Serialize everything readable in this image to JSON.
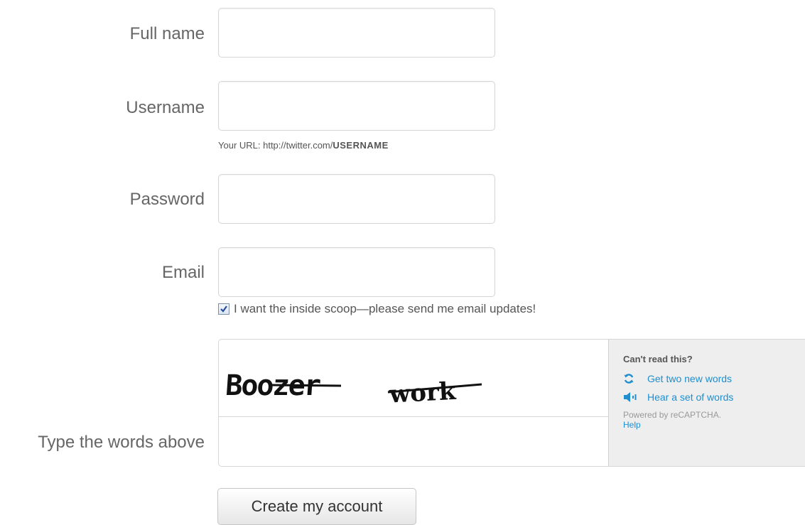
{
  "form": {
    "full_name": {
      "label": "Full name",
      "value": ""
    },
    "username": {
      "label": "Username",
      "value": "",
      "hint_prefix": "Your URL: http://twitter.com/",
      "hint_bold": "USERNAME"
    },
    "password": {
      "label": "Password",
      "value": ""
    },
    "email": {
      "label": "Email",
      "value": ""
    },
    "email_updates": {
      "checked": true,
      "label": "I want the inside scoop—please send me email updates!"
    },
    "captcha": {
      "label": "Type the words above",
      "words": [
        "Boozer",
        "work"
      ],
      "value": "",
      "side": {
        "heading": "Can't read this?",
        "new_words_link": "Get two new words",
        "audio_link": "Hear a set of words",
        "powered_by": "Powered by reCAPTCHA.",
        "help_link": "Help",
        "link_color": "#1e8ecf"
      }
    },
    "submit_label": "Create my account"
  }
}
